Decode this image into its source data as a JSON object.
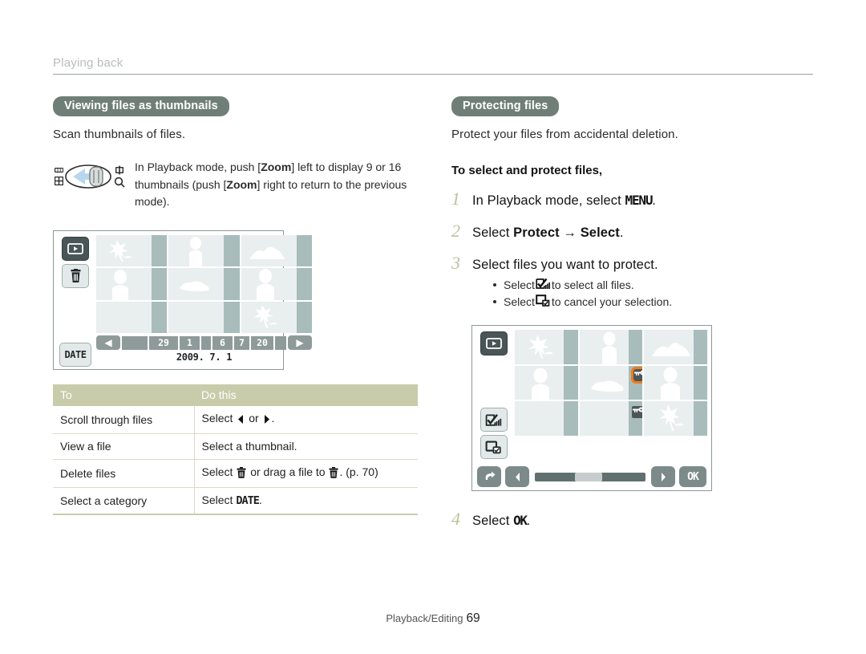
{
  "header": {
    "title": "Playing back"
  },
  "left": {
    "section_title": "Viewing files as thumbnails",
    "lead": "Scan thumbnails of files.",
    "zoom_note": {
      "part1": "In Playback mode, push [",
      "zoom1": "Zoom",
      "part2": "] left to display 9 or 16 thumbnails (push [",
      "zoom2": "Zoom",
      "part3": "] right to return to the previous mode)."
    },
    "screen": {
      "side_buttons": [
        "play-icon",
        "trash-icon",
        "DATE"
      ],
      "date_segments": [
        "",
        "29",
        "1",
        "",
        "6",
        "7",
        "20",
        ""
      ],
      "date_text": "2009. 7. 1",
      "prev_label": "◀",
      "next_label": "▶"
    },
    "table": {
      "headers": [
        "To",
        "Do this"
      ],
      "rows": [
        {
          "to": "Scroll through files",
          "do_pre": "Select ",
          "do_mid": " or ",
          "do_post": "."
        },
        {
          "to": "View a file",
          "do_pre": "Select a thumbnail.",
          "do_mid": "",
          "do_post": ""
        },
        {
          "to": "Delete files",
          "do_pre": "Select ",
          "do_mid": " or drag a file to ",
          "do_post": ". (p. 70)"
        },
        {
          "to": "Select a category",
          "do_pre": "Select ",
          "do_mid": "DATE",
          "do_post": "."
        }
      ]
    }
  },
  "right": {
    "section_title": "Protecting files",
    "lead": "Protect your files from accidental deletion.",
    "subhead": "To select and protect files,",
    "steps": [
      {
        "num": "1",
        "pre": "In Playback mode, select ",
        "bold": "MENU",
        "post": "."
      },
      {
        "num": "2",
        "pre": "Select ",
        "bold": "Protect",
        "arrow": " → ",
        "bold2": "Select",
        "post": "."
      },
      {
        "num": "3",
        "pre": "Select files you want to protect.",
        "bold": "",
        "post": ""
      },
      {
        "num": "4",
        "pre": "Select ",
        "bold": "OK",
        "post": "."
      }
    ],
    "bullets": [
      {
        "pre": "Select ",
        "icon": "select-all-icon",
        "post": " to select all files."
      },
      {
        "pre": "Select ",
        "icon": "deselect-icon",
        "post": " to cancel your selection."
      }
    ],
    "screen": {
      "side_buttons": [
        "play-icon",
        "select-all-icon",
        "deselect-icon"
      ],
      "back_label": "↶",
      "prev_label": "◀",
      "next_label": "▶",
      "ok_label": "OK",
      "protected_tags": 2
    }
  },
  "footer": {
    "label": "Playback/Editing",
    "page": "69"
  },
  "colors": {
    "pill": "#6f7f77",
    "table_header": "#c8ccaa",
    "step_number": "#b9c49a",
    "accent_orange": "#ef7b18",
    "thumb_light": "#e9eeee",
    "thumb_strip": "#a8bcbc"
  }
}
